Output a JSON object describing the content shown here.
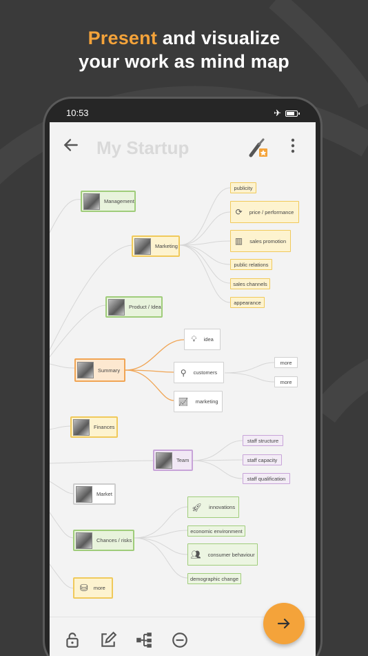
{
  "headline": {
    "accent": "Present",
    "line1_rest": " and visualize",
    "line2": "your work as mind map"
  },
  "status": {
    "time": "10:53"
  },
  "appbar": {
    "title": "My Startup"
  },
  "nodes": {
    "management": "Management",
    "marketing": "Marketing",
    "product_idea": "Product / Idea",
    "summary": "Summary",
    "finances": "Finances",
    "team": "Team",
    "market": "Market",
    "chances_risks": "Chances / risks",
    "more": "more"
  },
  "marketing_children": [
    "publicity",
    "price / performance",
    "sales promotion",
    "public relations",
    "sales channels",
    "appearance"
  ],
  "summary_children": [
    "idea",
    "customers",
    "marketing"
  ],
  "customers_children": [
    "more",
    "more"
  ],
  "team_children": [
    "staff structure",
    "staff capacity",
    "staff qualification"
  ],
  "chances_children": [
    "innovations",
    "economic environment",
    "consumer behaviour",
    "demographic change"
  ],
  "colors": {
    "accent": "#f4a33a",
    "green": "#9fcc7a",
    "yellow": "#f0c95a",
    "purple": "#c7a3d8"
  }
}
